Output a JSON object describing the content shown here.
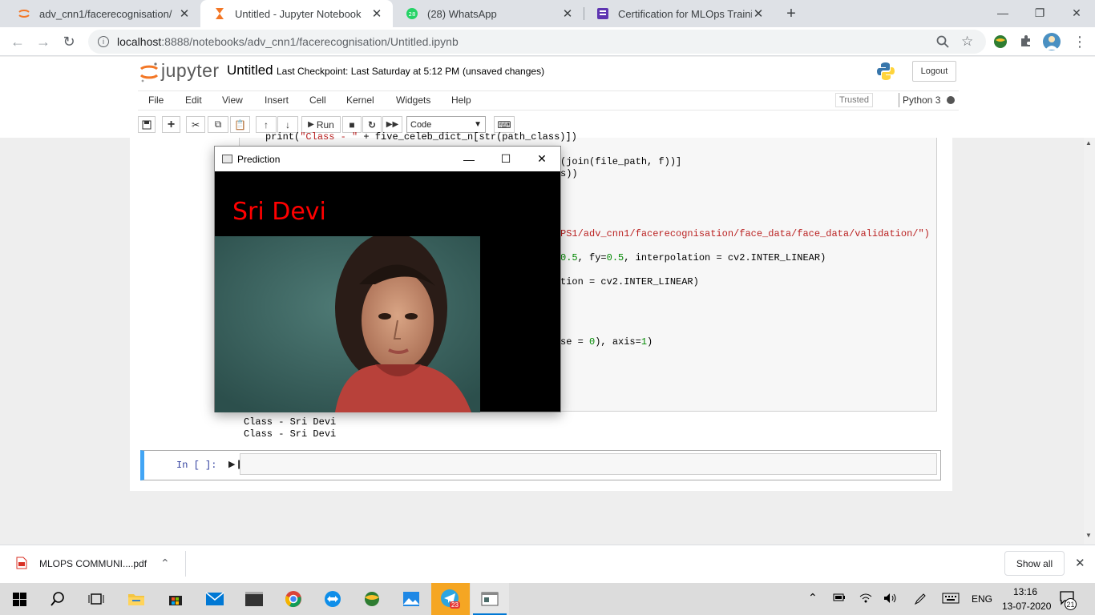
{
  "browser": {
    "tabs": [
      {
        "title": "adv_cnn1/facerecognisation/",
        "icon": "jupyter-tab-icon",
        "active": false
      },
      {
        "title": "Untitled - Jupyter Notebook",
        "icon": "hourglass-icon",
        "active": true
      },
      {
        "title": "(28) WhatsApp",
        "icon": "whatsapp-icon",
        "active": false
      },
      {
        "title": "Certification for MLOps Training",
        "icon": "training-icon",
        "active": false
      }
    ],
    "new_tab": "+",
    "url_host": "localhost",
    "url_rest": ":8888/notebooks/adv_cnn1/facerecognisation/Untitled.ipynb"
  },
  "jupyter": {
    "logo": "jupyter",
    "notebook_title": "Untitled",
    "checkpoint": "Last Checkpoint: Last Saturday at 5:12 PM",
    "status": "(unsaved changes)",
    "logout": "Logout",
    "menu": [
      "File",
      "Edit",
      "View",
      "Insert",
      "Cell",
      "Kernel",
      "Widgets",
      "Help"
    ],
    "trusted": "Trusted",
    "kernel": "Python 3",
    "run_label": "Run",
    "cell_type": "Code"
  },
  "code_lines": [
    {
      "pre": "print(",
      "str": "\"Class - \"",
      "post": " + five_celeb_dict_n[str(path_class)])"
    },
    {
      "pre": "",
      "str": "",
      "post": "(join(file_path, f))]"
    },
    {
      "pre": "",
      "str": "",
      "post": "s))"
    },
    {
      "pre": "",
      "str": "PS1/adv_cnn1/facerecognisation/face_data/face_data/validation/\")",
      "post": ""
    },
    {
      "pre": "",
      "num": "0.5",
      "post": ", fy=",
      "num2": "0.5",
      "post2": ", interpolation = cv2.INTER_LINEAR)"
    },
    {
      "pre": "tion = cv2.INTER_LINEAR)",
      "post": ""
    },
    {
      "pre": "se = ",
      "num": "0",
      "post": "), axis=",
      "num2": "1",
      "post2": ")"
    }
  ],
  "output_lines": [
    "Class - Sri Devi",
    "Class - Sri Devi"
  ],
  "in_prompt": "In [ ]:",
  "prediction_window": {
    "title": "Prediction",
    "label": "Sri Devi"
  },
  "download": {
    "filename": "MLOPS COMMUNI....pdf",
    "show_all": "Show all"
  },
  "taskbar": {
    "language": "ENG",
    "time": "13:16",
    "date": "13-07-2020",
    "notifications": "21",
    "telegram_badge": "23"
  },
  "colors": {
    "accent": "#42a5f5",
    "prediction_text": "#ff0000",
    "jupyter_orange": "#f37726"
  }
}
